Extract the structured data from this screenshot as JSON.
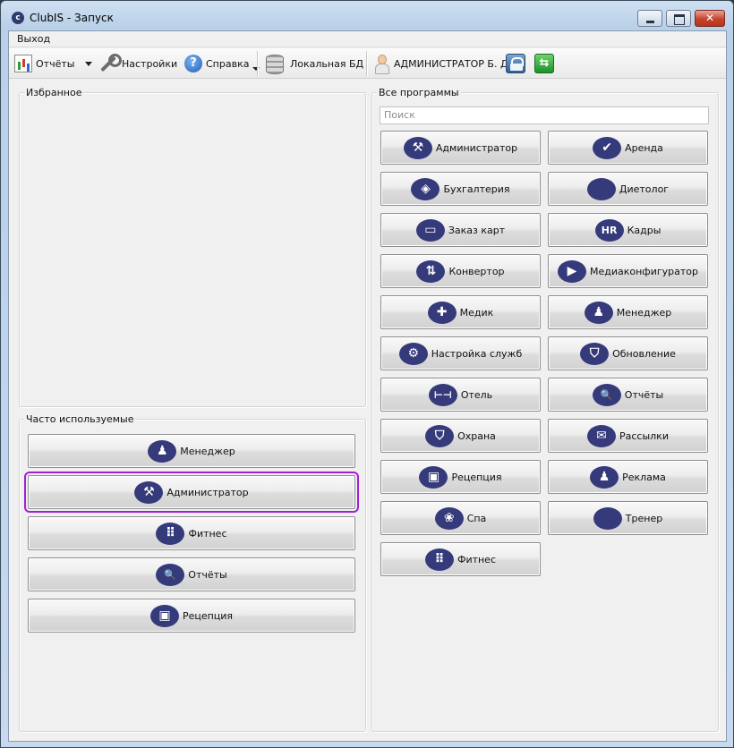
{
  "window": {
    "title": "ClubIS - Запуск"
  },
  "menu": {
    "exit": "Выход"
  },
  "toolbar": {
    "reports": "Отчёты",
    "settings": "Настройки",
    "help": "Справка",
    "db": "Локальная БД",
    "user": "АДМИНИСТРАТОР Б. Д."
  },
  "favorites": {
    "title": "Избранное"
  },
  "frequent": {
    "title": "Часто используемые",
    "items": [
      {
        "label": "Менеджер",
        "icon": "person-icon",
        "glyph": "♟"
      },
      {
        "label": "Администратор",
        "icon": "tools-icon",
        "glyph": "⚒",
        "selected": true
      },
      {
        "label": "Фитнес",
        "icon": "dots-icon",
        "glyph": "⠿"
      },
      {
        "label": "Отчёты",
        "icon": "magnifier-icon",
        "glyph": "🔍"
      },
      {
        "label": "Рецепция",
        "icon": "box-icon",
        "glyph": "▣"
      }
    ]
  },
  "programs": {
    "title": "Все программы",
    "search_placeholder": "Поиск",
    "items": [
      {
        "label": "Администратор",
        "icon": "tools-icon",
        "glyph": "⚒"
      },
      {
        "label": "Аренда",
        "icon": "check-icon",
        "glyph": "✔"
      },
      {
        "label": "Бухгалтерия",
        "icon": "tag-icon",
        "glyph": "◈"
      },
      {
        "label": "Диетолог",
        "icon": "oval-icon",
        "glyph": ""
      },
      {
        "label": "Заказ карт",
        "icon": "card-icon",
        "glyph": "▭"
      },
      {
        "label": "Кадры",
        "icon": "hr-icon",
        "glyph": "HR"
      },
      {
        "label": "Конвертор",
        "icon": "arrows-icon",
        "glyph": "⇅"
      },
      {
        "label": "Медиаконфигуратор",
        "icon": "play-icon",
        "glyph": "▶"
      },
      {
        "label": "Медик",
        "icon": "plus-icon",
        "glyph": "✚"
      },
      {
        "label": "Менеджер",
        "icon": "person-icon",
        "glyph": "♟"
      },
      {
        "label": "Настройка служб",
        "icon": "gear-icon",
        "glyph": "⚙"
      },
      {
        "label": "Обновление",
        "icon": "shield-icon",
        "glyph": "⛉"
      },
      {
        "label": "Отель",
        "icon": "bed-icon",
        "glyph": "⊢⊣"
      },
      {
        "label": "Отчёты",
        "icon": "magnifier-icon",
        "glyph": "🔍"
      },
      {
        "label": "Охрана",
        "icon": "shield-icon",
        "glyph": "⛉"
      },
      {
        "label": "Рассылки",
        "icon": "chat-icon",
        "glyph": "✉"
      },
      {
        "label": "Рецепция",
        "icon": "box-icon",
        "glyph": "▣"
      },
      {
        "label": "Реклама",
        "icon": "person-plus-icon",
        "glyph": "♟"
      },
      {
        "label": "Спа",
        "icon": "lotus-icon",
        "glyph": "❀"
      },
      {
        "label": "Тренер",
        "icon": "oval-icon",
        "glyph": ""
      },
      {
        "label": "Фитнес",
        "icon": "dots-icon",
        "glyph": "⠿"
      }
    ]
  }
}
